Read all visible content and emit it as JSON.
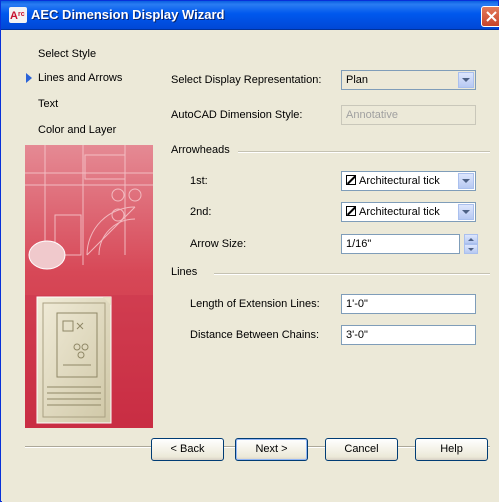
{
  "window": {
    "title": "AEC Dimension Display Wizard"
  },
  "nav": {
    "items": [
      {
        "label": "Select Style"
      },
      {
        "label": "Lines and Arrows"
      },
      {
        "label": "Text"
      },
      {
        "label": "Color and Layer"
      }
    ],
    "active": "Lines and Arrows"
  },
  "form": {
    "display_rep_label": "Select Display Representation:",
    "display_rep_value": "Plan",
    "dim_style_label": "AutoCAD Dimension Style:",
    "dim_style_value": "Annotative",
    "arrowheads_heading": "Arrowheads",
    "first_label": "1st:",
    "first_value": "Architectural tick",
    "second_label": "2nd:",
    "second_value": "Architectural tick",
    "arrow_size_label": "Arrow Size:",
    "arrow_size_value": "1/16\"",
    "lines_heading": "Lines",
    "ext_lines_label": "Length of Extension Lines:",
    "ext_lines_value": "1'-0\"",
    "chains_label": "Distance Between Chains:",
    "chains_value": "3'-0\""
  },
  "buttons": {
    "back": "< Back",
    "next": "Next >",
    "cancel": "Cancel",
    "help": "Help"
  },
  "colors": {
    "title_bar": "#0058ee",
    "accent_arrow": "#2a63d8",
    "art_primary": "#d23b4e"
  }
}
